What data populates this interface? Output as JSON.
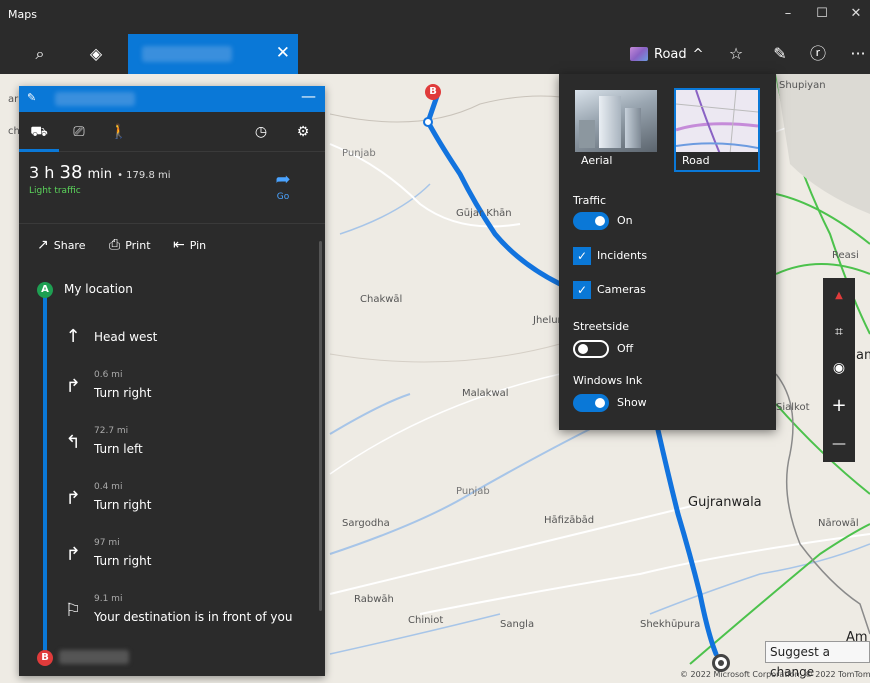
{
  "window": {
    "title": "Maps",
    "minimize": "–",
    "maximize": "☐",
    "close": "✕"
  },
  "cmdbar": {
    "search_icon": "⌕",
    "directions_icon": "◈",
    "tab_close": "✕",
    "map_style_label": "Road",
    "map_style_chevron": "^",
    "favorites_icon": "☆",
    "ink_icon": "✎",
    "account_icon": "ⓡ",
    "more_icon": "···"
  },
  "panel": {
    "pen_icon": "✎",
    "minimize_icon": "—",
    "modes": [
      {
        "name": "driving",
        "glyph": "⛟",
        "active": true
      },
      {
        "name": "transit",
        "glyph": "⎚",
        "active": false
      },
      {
        "name": "walking",
        "glyph": "🚶",
        "active": false
      }
    ],
    "clock_icon": "◷",
    "settings_icon": "⚙",
    "summary": {
      "time_h": "3 h",
      "time_m": "38",
      "time_unit": "min",
      "distance": "• 179.8 mi",
      "traffic": "Light traffic"
    },
    "go": {
      "glyph": "➦",
      "label": "Go"
    },
    "actions": [
      {
        "name": "share",
        "icon": "↗",
        "label": "Share"
      },
      {
        "name": "print",
        "icon": "⎙",
        "label": "Print"
      },
      {
        "name": "pin",
        "icon": "⇤",
        "label": "Pin"
      }
    ],
    "start": {
      "pin": "A",
      "label": "My location"
    },
    "steps": [
      {
        "icon": "↑",
        "distance": "",
        "label": "Head west"
      },
      {
        "icon": "↱",
        "distance": "0.6 mi",
        "label": "Turn right"
      },
      {
        "icon": "↰",
        "distance": "72.7 mi",
        "label": "Turn left"
      },
      {
        "icon": "↱",
        "distance": "0.4 mi",
        "label": "Turn right"
      },
      {
        "icon": "↱",
        "distance": "97 mi",
        "label": "Turn right"
      },
      {
        "icon": "⚐",
        "distance": "9.1 mi",
        "label": "Your destination is in front of you"
      }
    ],
    "end": {
      "pin": "B"
    }
  },
  "map_style_popup": {
    "tiles": [
      {
        "name": "Aerial",
        "selected": false
      },
      {
        "name": "Road",
        "selected": true
      }
    ],
    "traffic": {
      "title": "Traffic",
      "state": "On",
      "on": true
    },
    "incidents": {
      "label": "Incidents",
      "checked": true
    },
    "cameras": {
      "label": "Cameras",
      "checked": true
    },
    "streetside": {
      "title": "Streetside",
      "state": "Off",
      "on": false
    },
    "ink": {
      "title": "Windows Ink",
      "state": "Show",
      "on": true
    }
  },
  "map": {
    "labels": [
      {
        "text": "Punjab",
        "kind": "region"
      },
      {
        "text": "Gūjar Khān",
        "kind": "town"
      },
      {
        "text": "Chakwāl",
        "kind": "town"
      },
      {
        "text": "Jhelum",
        "kind": "town"
      },
      {
        "text": "Malakwal",
        "kind": "town"
      },
      {
        "text": "Punjab",
        "kind": "region"
      },
      {
        "text": "Gujranwala",
        "kind": "city"
      },
      {
        "text": "Sargodha",
        "kind": "town"
      },
      {
        "text": "Hāfizābād",
        "kind": "town"
      },
      {
        "text": "Rabwāh",
        "kind": "town"
      },
      {
        "text": "Chiniot",
        "kind": "town"
      },
      {
        "text": "Sangla",
        "kind": "town"
      },
      {
        "text": "Shekhūpura",
        "kind": "town"
      },
      {
        "text": "Shupiyan",
        "kind": "town"
      },
      {
        "text": "Reasi",
        "kind": "town"
      },
      {
        "text": "Sialkot",
        "kind": "town"
      },
      {
        "text": "Nārowāl",
        "kind": "town"
      },
      {
        "text": "am",
        "kind": "town"
      },
      {
        "text": "Am",
        "kind": "town"
      },
      {
        "text": "ar",
        "kind": "town"
      },
      {
        "text": "ch",
        "kind": "town"
      }
    ],
    "route_end_pin": "B",
    "suggest": "Suggest a change",
    "copyright": "© 2022 Microsoft Corporation, © 2022 TomTom"
  },
  "zoombar": {
    "compass": "▲",
    "tilt": "⌗",
    "locate": "◉",
    "zoom_in": "+",
    "zoom_out": "—"
  },
  "colors": {
    "accent": "#0a78d7",
    "route": "#1273de",
    "panel_bg": "#2b2b2b",
    "traffic": "#5bd35b",
    "pin_a": "#1e9f52",
    "pin_b": "#e03b3b"
  }
}
